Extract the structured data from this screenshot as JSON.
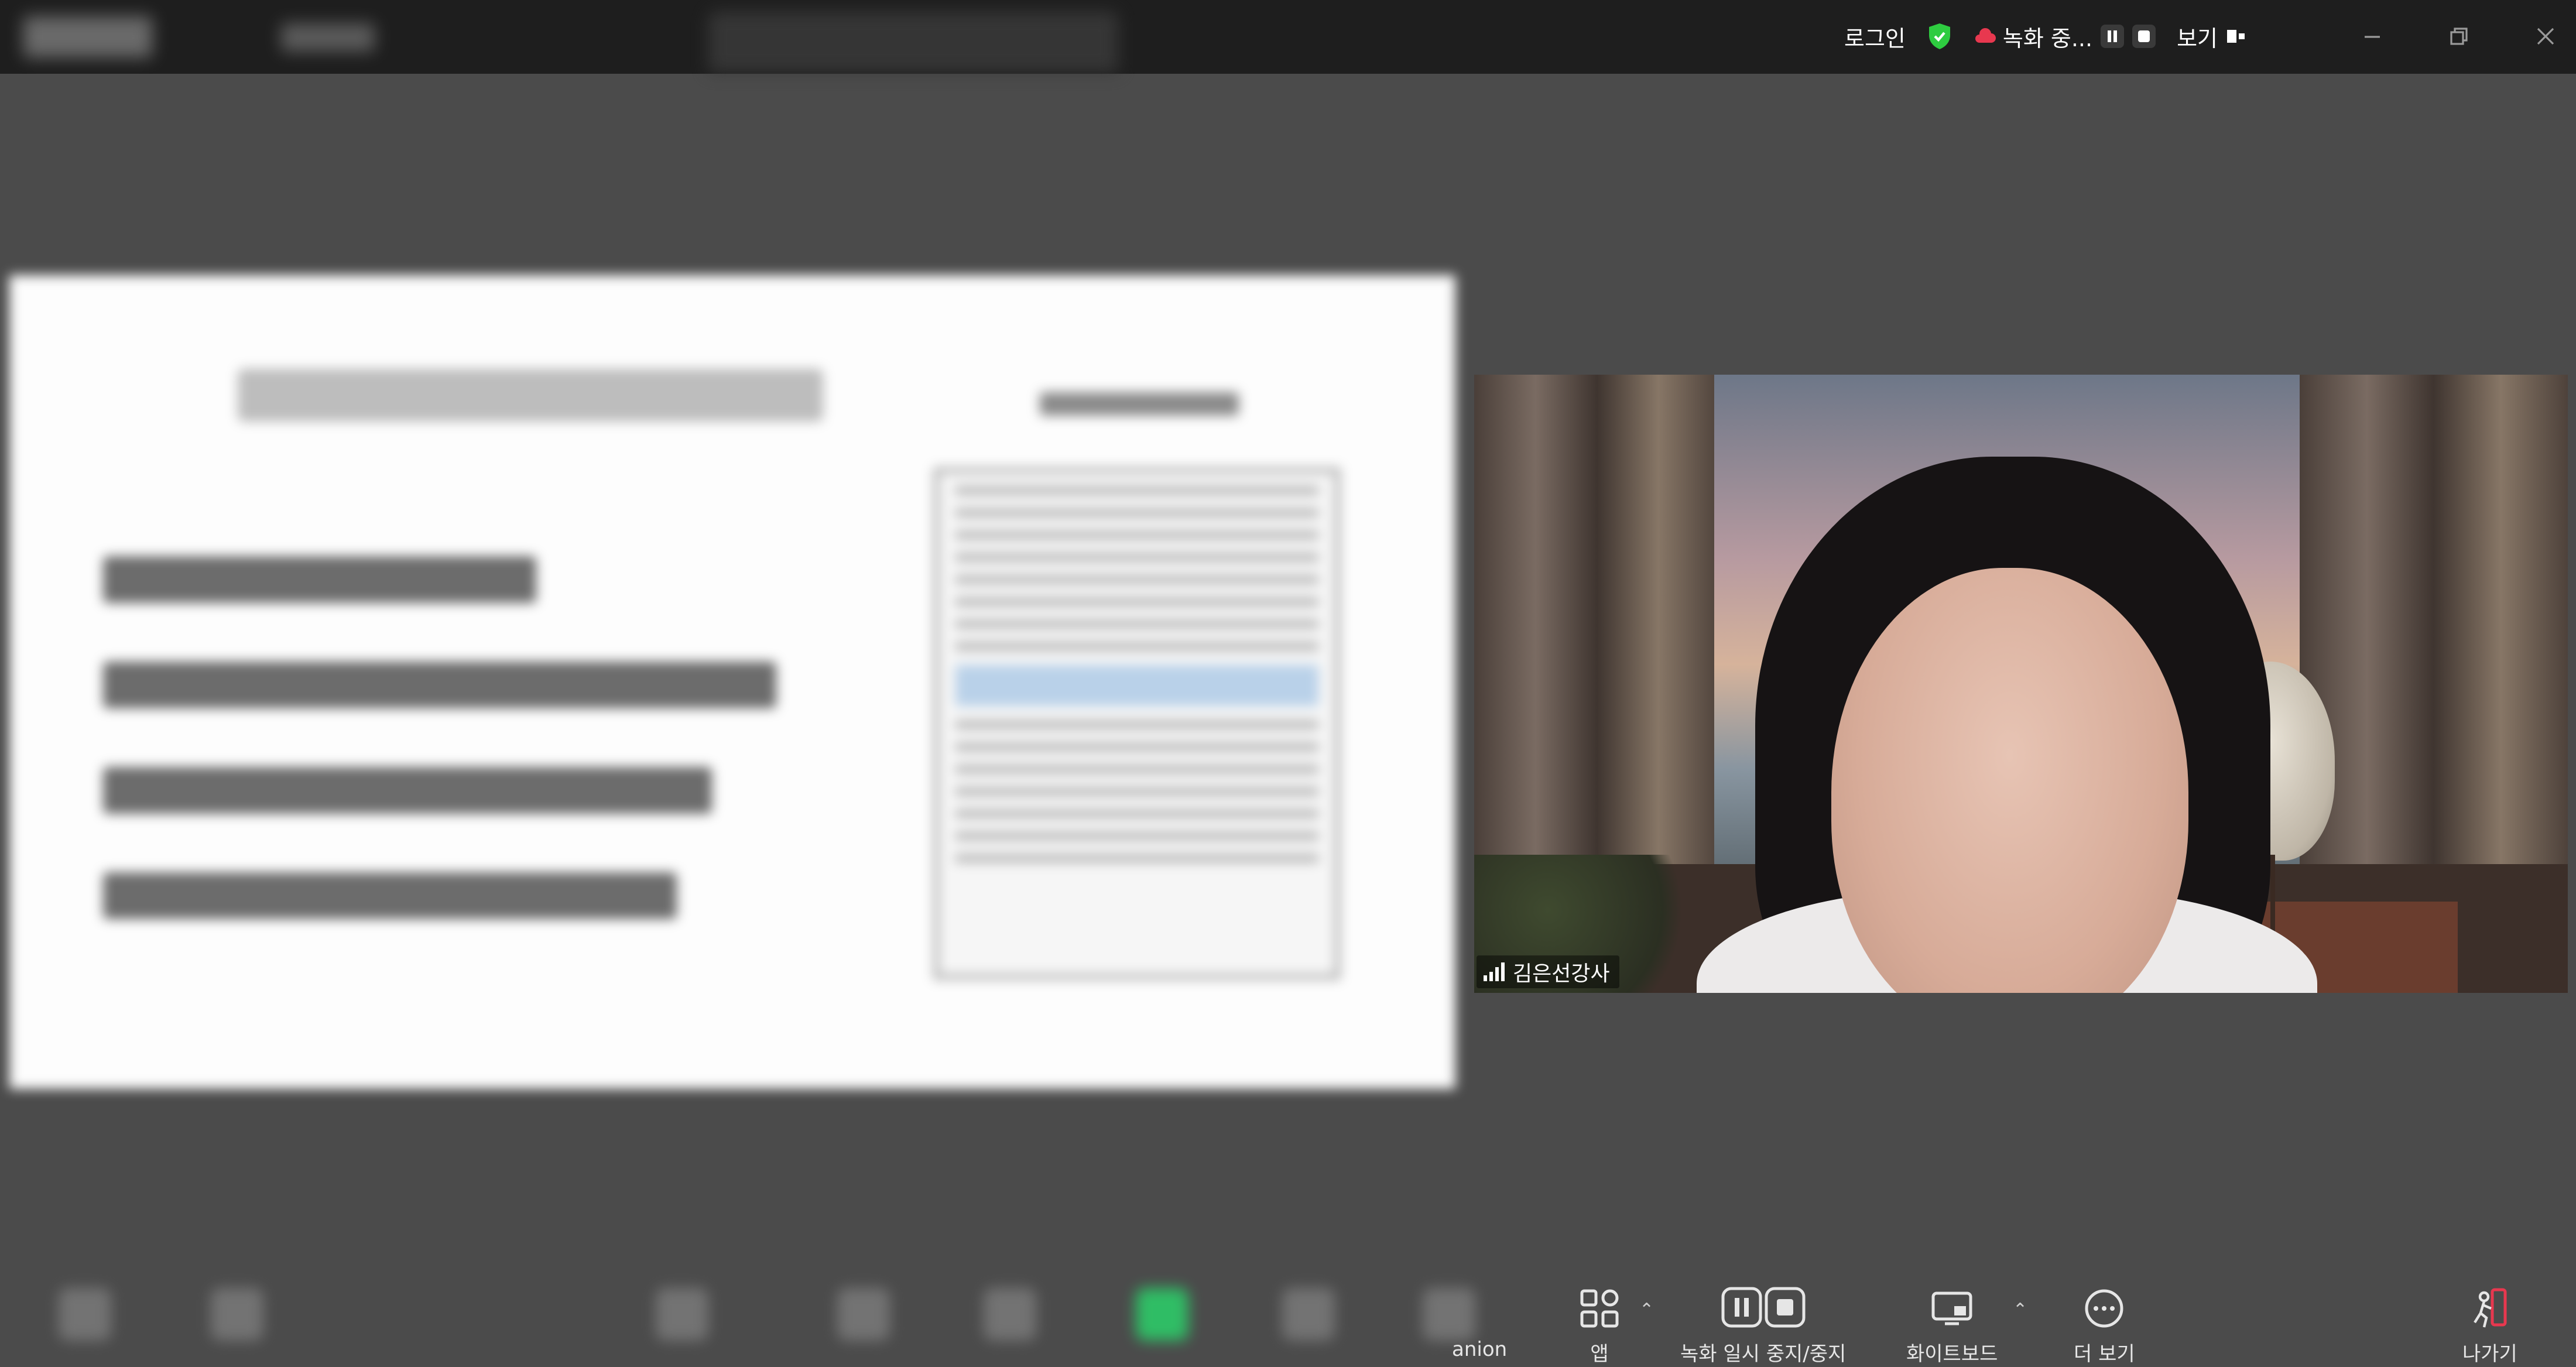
{
  "topbar": {
    "login_label": "로그인",
    "recording_label": "녹화 중...",
    "view_label": "보기"
  },
  "video": {
    "participant_name": "김은선강사"
  },
  "toolbar": {
    "companion_fragment": "anion",
    "apps_label": "앱",
    "record_label": "녹화 일시 중지/중지",
    "whiteboard_label": "화이트보드",
    "more_label": "더 보기",
    "leave_label": "나가기"
  },
  "colors": {
    "shield_green": "#2ecc40",
    "leave_red": "#e8384f"
  }
}
